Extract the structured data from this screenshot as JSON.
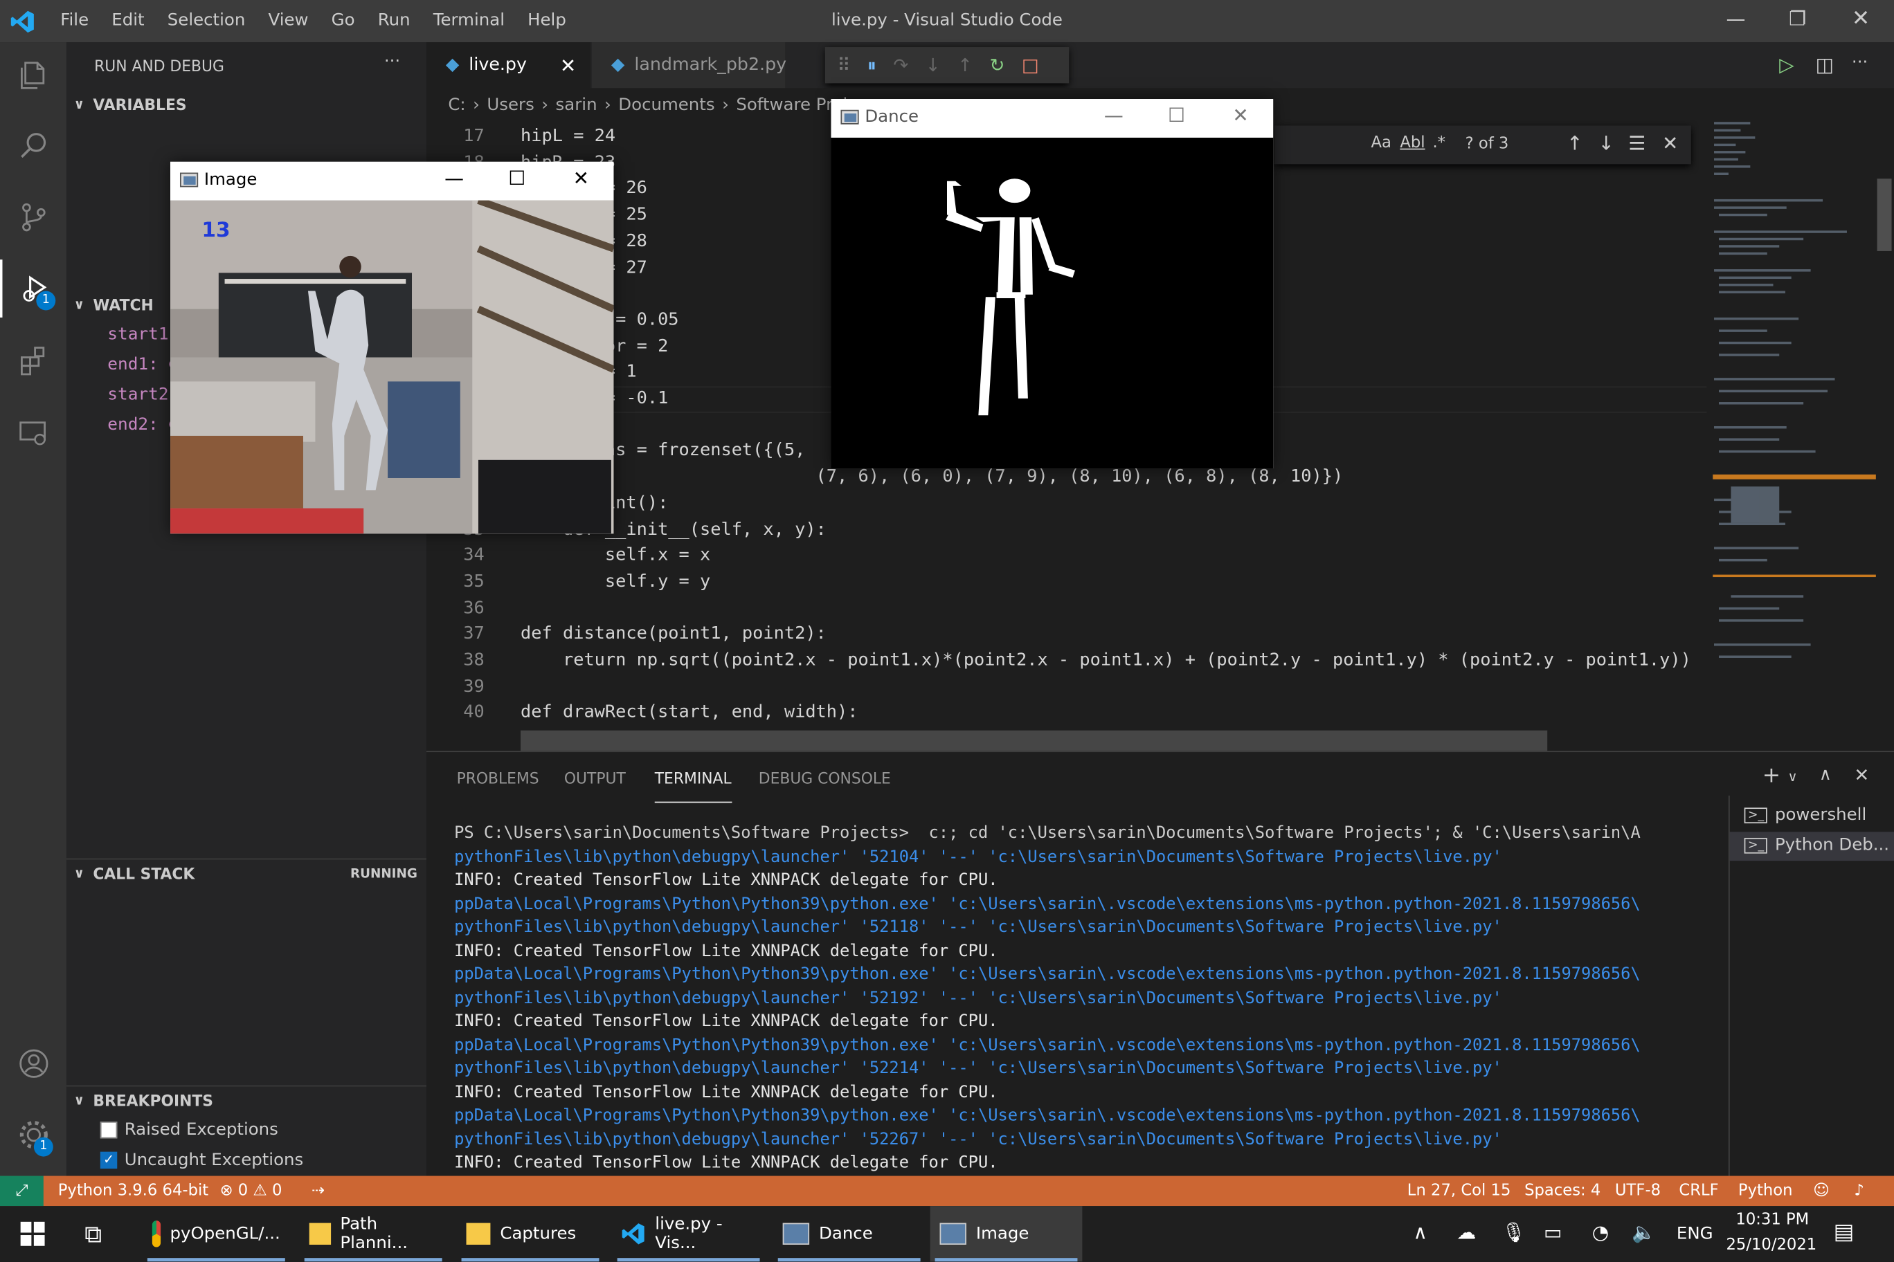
{
  "window": {
    "title": "live.py - Visual Studio Code",
    "menu": [
      "File",
      "Edit",
      "Selection",
      "View",
      "Go",
      "Run",
      "Terminal",
      "Help"
    ]
  },
  "activity": {
    "debug_badge": "1",
    "settings_badge": "1"
  },
  "sidebar": {
    "header": "RUN AND DEBUG",
    "more": "···",
    "variables": "VARIABLES",
    "watch": "WATCH",
    "watch_items": [
      "start1",
      "end1: ⊘",
      "start2",
      "end2: ⊘"
    ],
    "callstack": "CALL STACK",
    "callstack_status": "RUNNING",
    "breakpoints": "BREAKPOINTS",
    "bp_items": [
      {
        "label": "Raised Exceptions",
        "checked": false
      },
      {
        "label": "Uncaught Exceptions",
        "checked": true
      }
    ]
  },
  "tabs": [
    {
      "label": "live.py",
      "active": true
    },
    {
      "label": "landmark_pb2.py",
      "active": false
    }
  ],
  "breadcrumb": [
    "C:",
    "Users",
    "sarin",
    "Documents",
    "Software Proj"
  ],
  "find": {
    "count": "? of 3",
    "case": "Aa",
    "word": "Abl",
    "regex": ".*"
  },
  "code": [
    {
      "n": "17",
      "t": "hipL = 24"
    },
    {
      "n": "18",
      "t": "hipR = 23"
    },
    {
      "n": "",
      "t": "        = 26"
    },
    {
      "n": "",
      "t": "        = 25"
    },
    {
      "n": "",
      "t": "        = 28"
    },
    {
      "n": "",
      "t": "        = 27"
    },
    {
      "n": "",
      "t": ""
    },
    {
      "n": "",
      "t": "         = 0.05"
    },
    {
      "n": "",
      "t": "        or = 2"
    },
    {
      "n": "",
      "t": "        = 1"
    },
    {
      "n": "",
      "t": "        = -0.1"
    },
    {
      "n": "",
      "t": ""
    },
    {
      "n": "",
      "t": "        ns = frozenset({(5,"
    },
    {
      "n": "",
      "t": "                            (7, 6), (6, 0), (7, 9), (8, 10), (6, 8), (8, 10)})"
    },
    {
      "n": "32",
      "t": "class point():"
    },
    {
      "n": "33",
      "t": "    def __init__(self, x, y):"
    },
    {
      "n": "34",
      "t": "        self.x = x"
    },
    {
      "n": "35",
      "t": "        self.y = y"
    },
    {
      "n": "36",
      "t": ""
    },
    {
      "n": "37",
      "t": "def distance(point1, point2):"
    },
    {
      "n": "38",
      "t": "    return np.sqrt((point2.x - point1.x)*(point2.x - point1.x) + (point2.y - point1.y) * (point2.y - point1.y))"
    },
    {
      "n": "39",
      "t": ""
    },
    {
      "n": "40",
      "t": "def drawRect(start, end, width):"
    }
  ],
  "panel": {
    "tabs": [
      "PROBLEMS",
      "OUTPUT",
      "TERMINAL",
      "DEBUG CONSOLE"
    ],
    "terminals": [
      "powershell",
      "Python Deb..."
    ],
    "lines": [
      {
        "c": "p",
        "t": "PS C:\\Users\\sarin\\Documents\\Software Projects>  c:; cd 'c:\\Users\\sarin\\Documents\\Software Projects'; & 'C:\\Users\\sarin\\A"
      },
      {
        "c": "b",
        "t": "pythonFiles\\lib\\python\\debugpy\\launcher' '52104' '--' 'c:\\Users\\sarin\\Documents\\Software Projects\\live.py'"
      },
      {
        "c": "w",
        "t": "INFO: Created TensorFlow Lite XNNPACK delegate for CPU."
      },
      {
        "c": "b",
        "t": "ppData\\Local\\Programs\\Python\\Python39\\python.exe' 'c:\\Users\\sarin\\.vscode\\extensions\\ms-python.python-2021.8.1159798656\\"
      },
      {
        "c": "b",
        "t": "pythonFiles\\lib\\python\\debugpy\\launcher' '52118' '--' 'c:\\Users\\sarin\\Documents\\Software Projects\\live.py'"
      },
      {
        "c": "w",
        "t": "INFO: Created TensorFlow Lite XNNPACK delegate for CPU."
      },
      {
        "c": "b",
        "t": "ppData\\Local\\Programs\\Python\\Python39\\python.exe' 'c:\\Users\\sarin\\.vscode\\extensions\\ms-python.python-2021.8.1159798656\\"
      },
      {
        "c": "b",
        "t": "pythonFiles\\lib\\python\\debugpy\\launcher' '52192' '--' 'c:\\Users\\sarin\\Documents\\Software Projects\\live.py'"
      },
      {
        "c": "w",
        "t": "INFO: Created TensorFlow Lite XNNPACK delegate for CPU."
      },
      {
        "c": "b",
        "t": "ppData\\Local\\Programs\\Python\\Python39\\python.exe' 'c:\\Users\\sarin\\.vscode\\extensions\\ms-python.python-2021.8.1159798656\\"
      },
      {
        "c": "b",
        "t": "pythonFiles\\lib\\python\\debugpy\\launcher' '52214' '--' 'c:\\Users\\sarin\\Documents\\Software Projects\\live.py'"
      },
      {
        "c": "w",
        "t": "INFO: Created TensorFlow Lite XNNPACK delegate for CPU."
      },
      {
        "c": "b",
        "t": "ppData\\Local\\Programs\\Python\\Python39\\python.exe' 'c:\\Users\\sarin\\.vscode\\extensions\\ms-python.python-2021.8.1159798656\\"
      },
      {
        "c": "b",
        "t": "pythonFiles\\lib\\python\\debugpy\\launcher' '52267' '--' 'c:\\Users\\sarin\\Documents\\Software Projects\\live.py'"
      },
      {
        "c": "w",
        "t": "INFO: Created TensorFlow Lite XNNPACK delegate for CPU."
      }
    ]
  },
  "status": {
    "python": "Python 3.9.6 64-bit",
    "errors": "⊗ 0 ⚠ 0",
    "position": "Ln 27, Col 15",
    "spaces": "Spaces: 4",
    "encoding": "UTF-8",
    "eol": "CRLF",
    "language": "Python",
    "bg": "#cc6633"
  },
  "image_window": {
    "title": "Image",
    "overlay": "13"
  },
  "dance_window": {
    "title": "Dance"
  },
  "taskbar": {
    "apps": [
      "pyOpenGL/...",
      "Path Planni...",
      "Captures",
      "live.py - Vis...",
      "Dance",
      "Image"
    ],
    "lang": "ENG",
    "time": "10:31 PM",
    "date": "25/10/2021"
  }
}
